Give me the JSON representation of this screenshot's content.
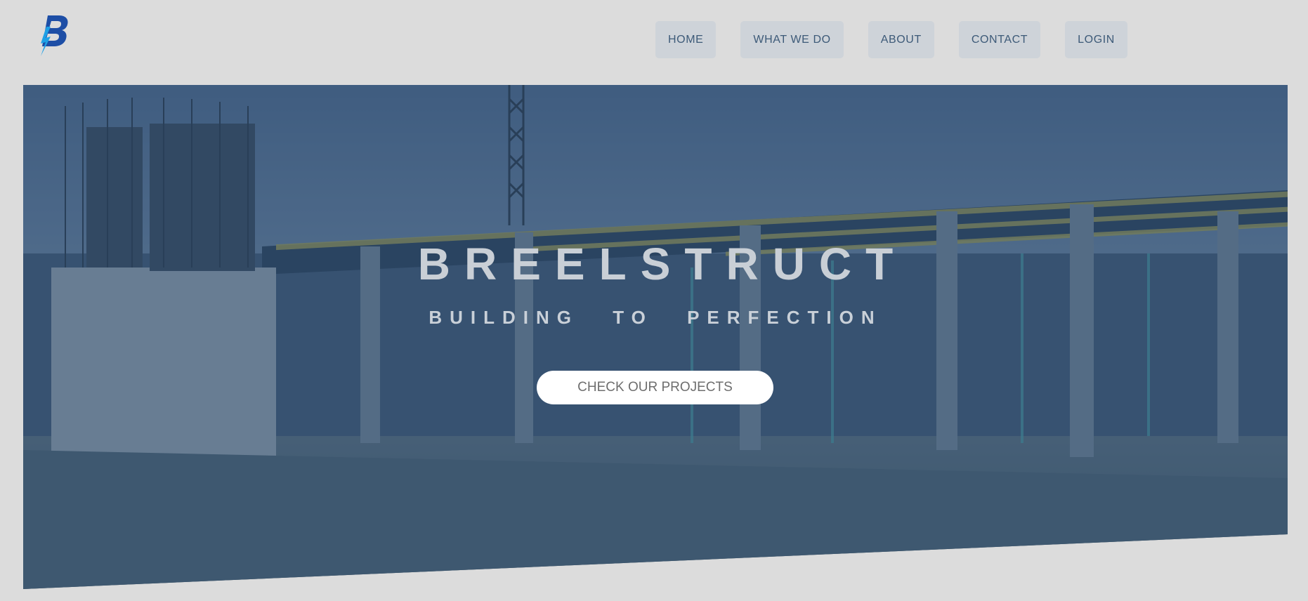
{
  "header": {
    "logo_icon": "brand-b-lightning-logo",
    "brand_colors": [
      "#1d4ea6",
      "#1ea0e6"
    ]
  },
  "nav": {
    "items": [
      {
        "label": "HOME"
      },
      {
        "label": "WHAT WE DO"
      },
      {
        "label": "ABOUT"
      },
      {
        "label": "CONTACT"
      },
      {
        "label": "LOGIN"
      }
    ]
  },
  "hero": {
    "title": "BREELSTRUCT",
    "subtitle": "BUILDING TO PERFECTION",
    "cta_label": "CHECK OUR PROJECTS",
    "background_image": "construction-site-photo",
    "overlay_color": "#28486e"
  }
}
